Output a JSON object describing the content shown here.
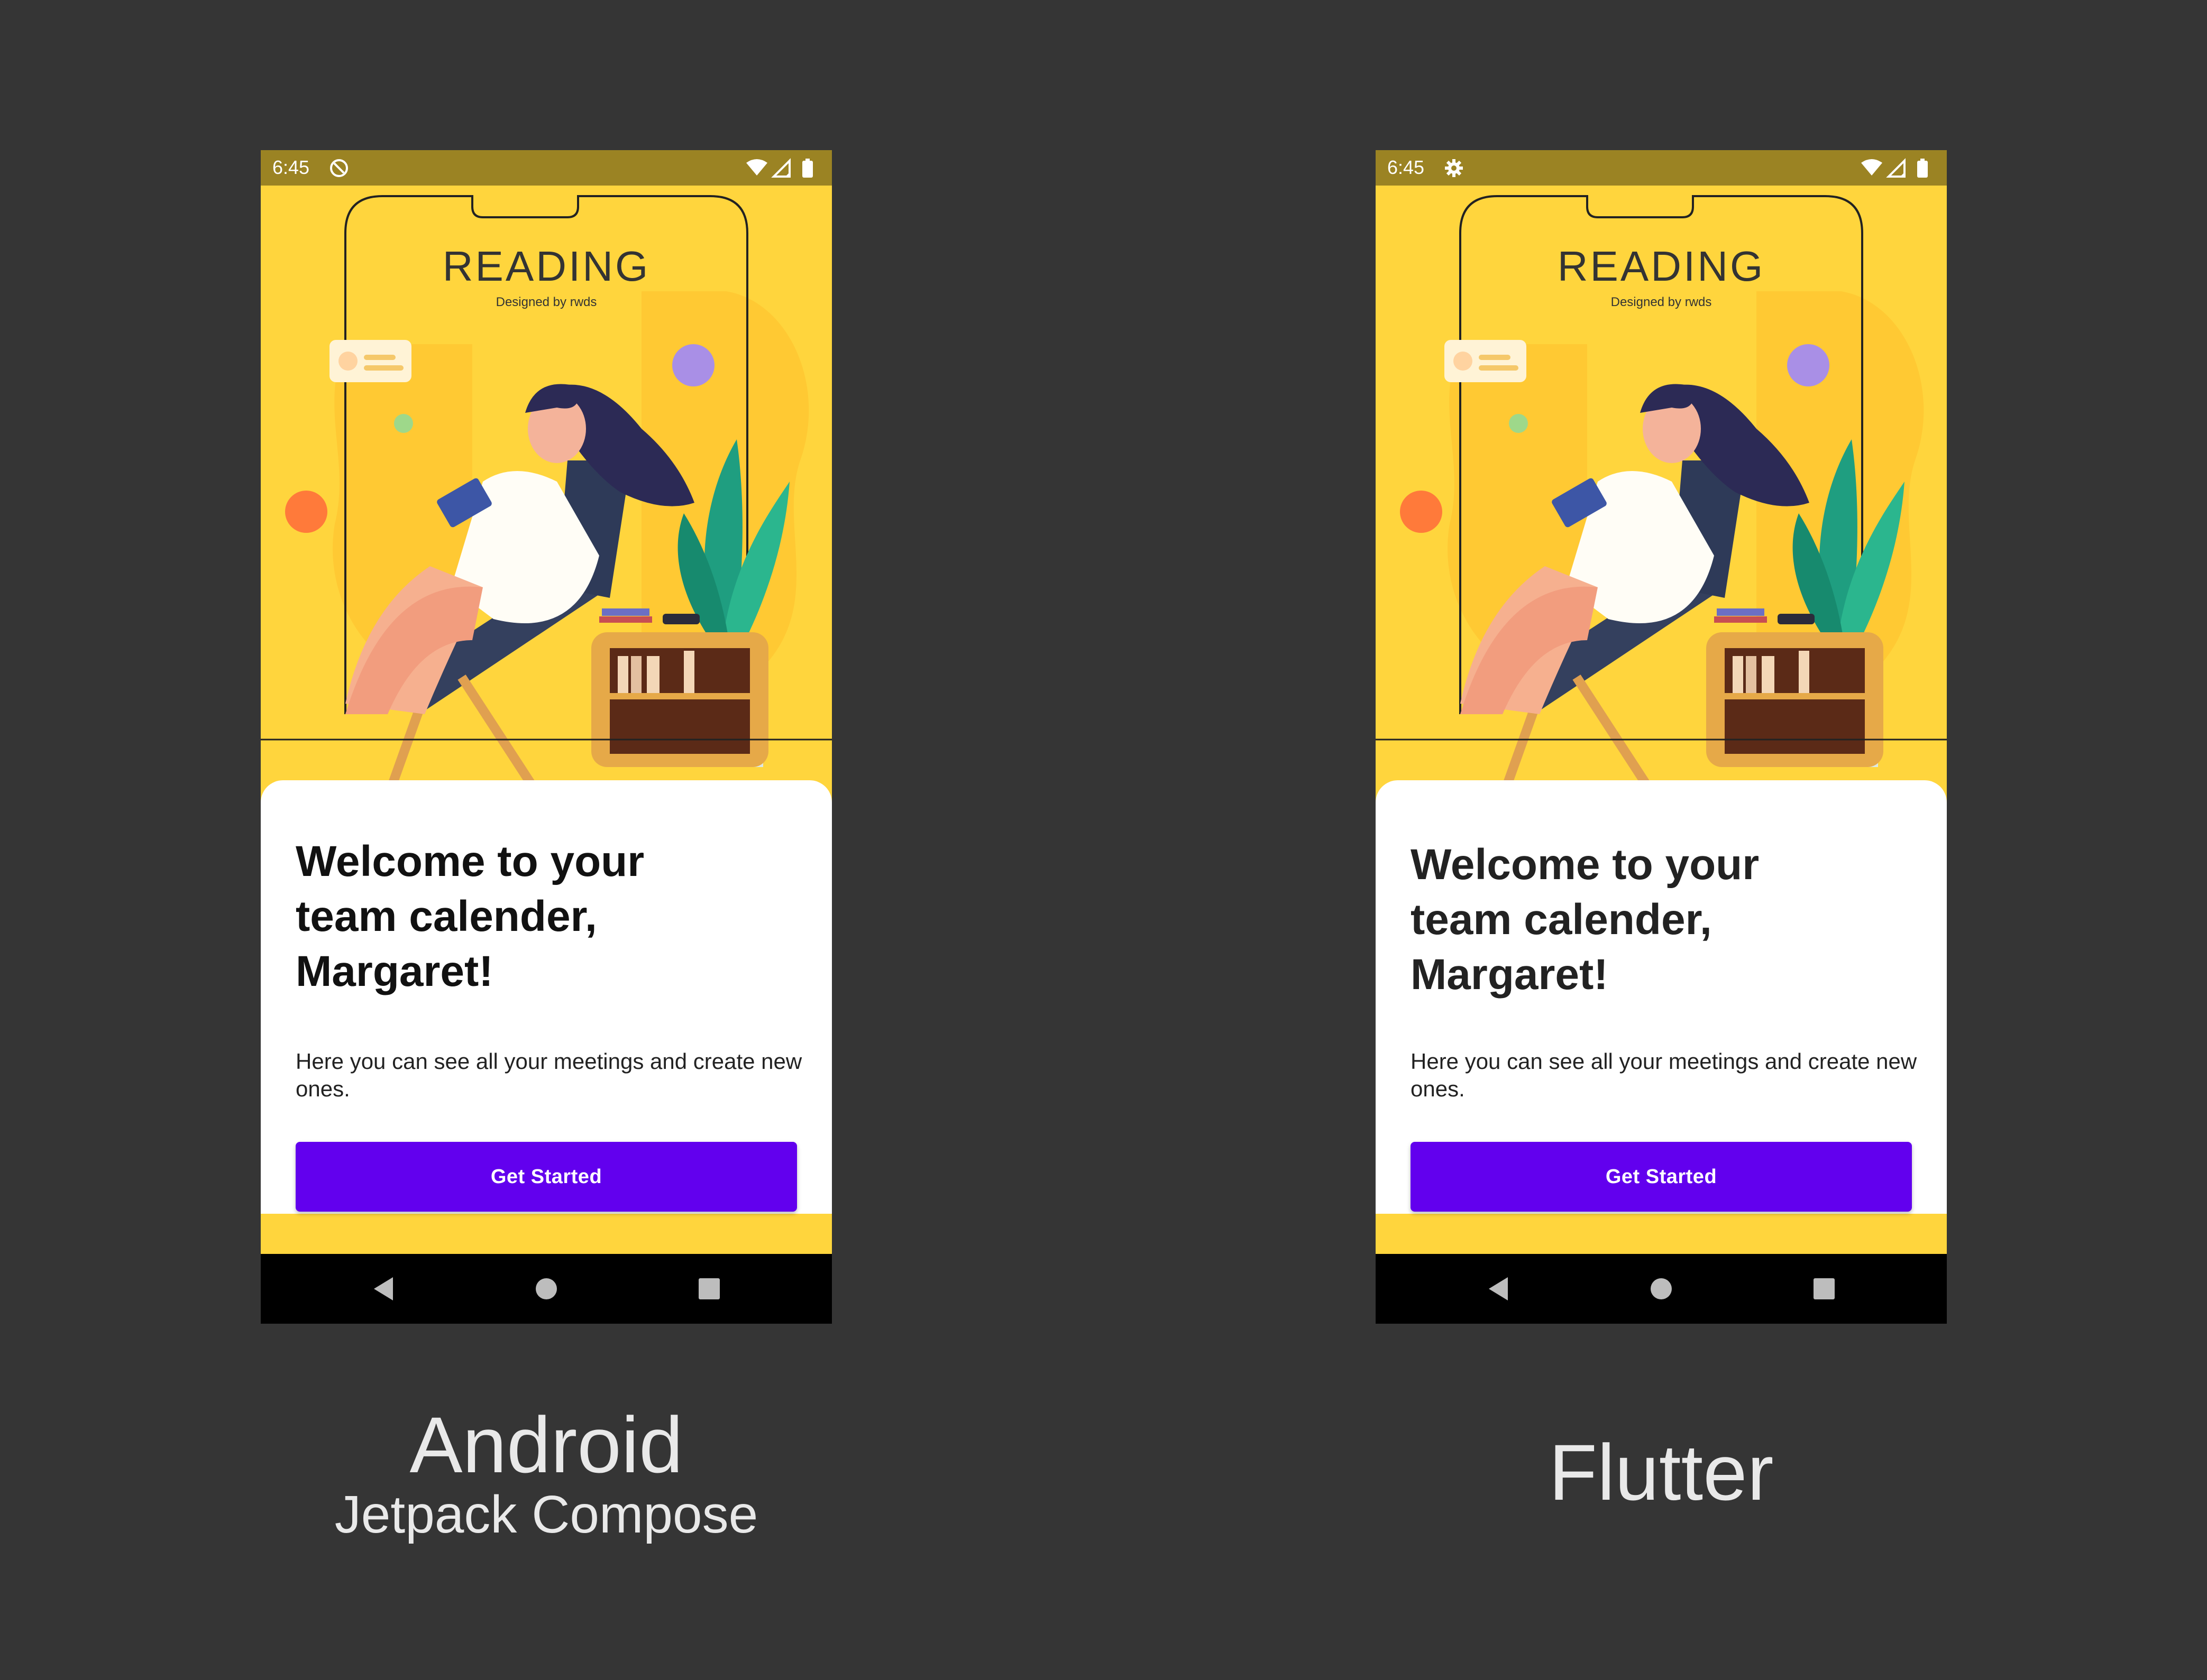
{
  "colors": {
    "background": "#353535",
    "status_bar": "#9B8323",
    "illustration_bg": "#FFD53D",
    "button": "#6200EE",
    "nav_bar": "#000000"
  },
  "screens": [
    {
      "platform": "android",
      "status_bar": {
        "time": "6:45",
        "left_icon": "do-not-disturb-icon",
        "right_icons": [
          "wifi-icon",
          "signal-icon",
          "battery-icon"
        ]
      },
      "illustration": {
        "title": "READING",
        "credit": "Designed by rwds"
      },
      "card": {
        "headline": "Welcome to your team calender, Margaret!",
        "body": "Here you can see all your meetings and create new ones.",
        "button_label": "Get Started"
      },
      "nav_bar": [
        "back-icon",
        "home-icon",
        "recents-icon"
      ]
    },
    {
      "platform": "flutter",
      "status_bar": {
        "time": "6:45",
        "left_icon": "gear-icon",
        "right_icons": [
          "wifi-icon",
          "signal-icon",
          "battery-icon"
        ]
      },
      "illustration": {
        "title": "READING",
        "credit": "Designed by rwds"
      },
      "card": {
        "headline": "Welcome to your team calender, Margaret!",
        "body": "Here you can see all your meetings and create new ones.",
        "button_label": "Get Started"
      },
      "nav_bar": [
        "back-icon",
        "home-icon",
        "recents-icon"
      ]
    }
  ],
  "captions": {
    "android_title": "Android",
    "android_subtitle": "Jetpack Compose",
    "flutter_title": "Flutter"
  }
}
